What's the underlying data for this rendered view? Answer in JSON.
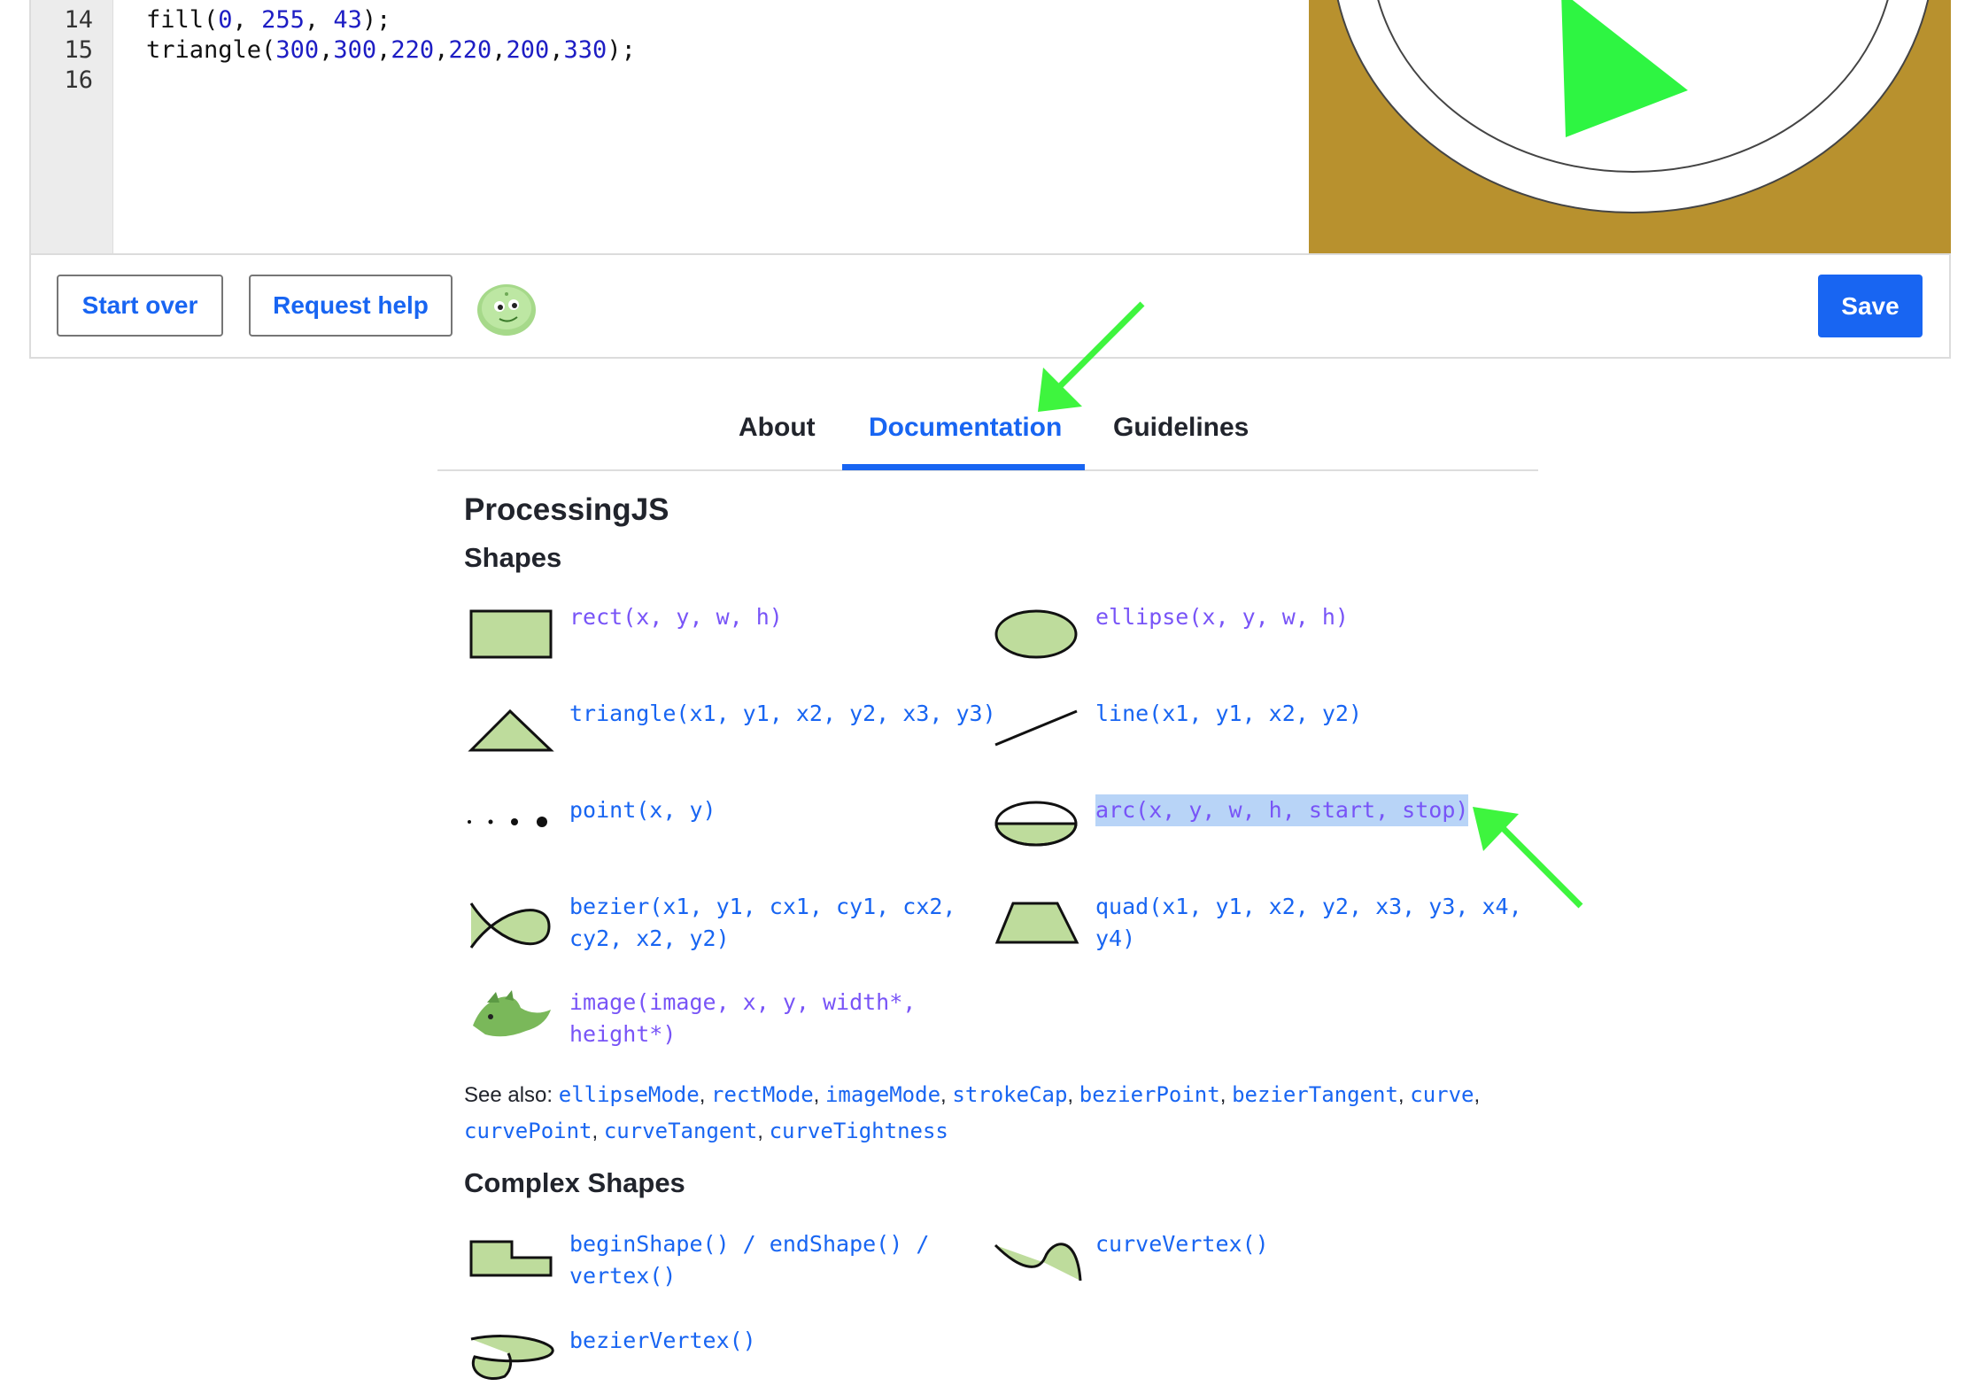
{
  "editor": {
    "lines": [
      {
        "n": "14",
        "text": "fill(0, 255, 43);"
      },
      {
        "n": "15",
        "text": "triangle(300,300,220,220,200,330);"
      },
      {
        "n": "16",
        "text": ""
      }
    ]
  },
  "toolbar": {
    "start_over": "Start over",
    "request_help": "Request help",
    "save": "Save"
  },
  "tabs": {
    "about": "About",
    "documentation": "Documentation",
    "guidelines": "Guidelines"
  },
  "doc": {
    "title": "ProcessingJS",
    "shapes_heading": "Shapes",
    "shapes": {
      "rect": "rect(x, y, w, h)",
      "ellipse": "ellipse(x, y, w, h)",
      "triangle": "triangle(x1, y1, x2, y2, x3, y3)",
      "line": "line(x1, y1, x2, y2)",
      "point": "point(x, y)",
      "arc": "arc(x, y, w, h, start, stop)",
      "bezier_1": "bezier(x1, y1, cx1, cy1, cx2,",
      "bezier_2": "cy2, x2, y2)",
      "quad_1": "quad(x1, y1, x2, y2, x3, y3, x4,",
      "quad_2": "y4)",
      "image_1": "image(image, x, y, width*,",
      "image_2": "height*)"
    },
    "see_also_label": "See also:",
    "see_also": [
      "ellipseMode",
      "rectMode",
      "imageMode",
      "strokeCap",
      "bezierPoint",
      "bezierTangent",
      "curve",
      "curvePoint",
      "curveTangent",
      "curveTightness"
    ],
    "complex_heading": "Complex Shapes",
    "complex": {
      "begin_1": "beginShape() / endShape() /",
      "begin_2": "vertex()",
      "curve_vertex": "curveVertex()",
      "bezier_vertex": "bezierVertex()"
    }
  },
  "colors": {
    "accent": "#1865f2",
    "purple": "#7854f7",
    "canvas_bg": "#b8912e",
    "triangle_fill": "#2ef542",
    "arrow": "#3ef53e",
    "icon_fill": "#bedc9c"
  },
  "icons": [
    "avatar-icon",
    "rect-icon",
    "ellipse-icon",
    "triangle-icon",
    "line-icon",
    "point-icon",
    "arc-icon",
    "bezier-icon",
    "quad-icon",
    "image-icon",
    "begin-shape-icon",
    "curve-vertex-icon",
    "bezier-vertex-icon"
  ]
}
